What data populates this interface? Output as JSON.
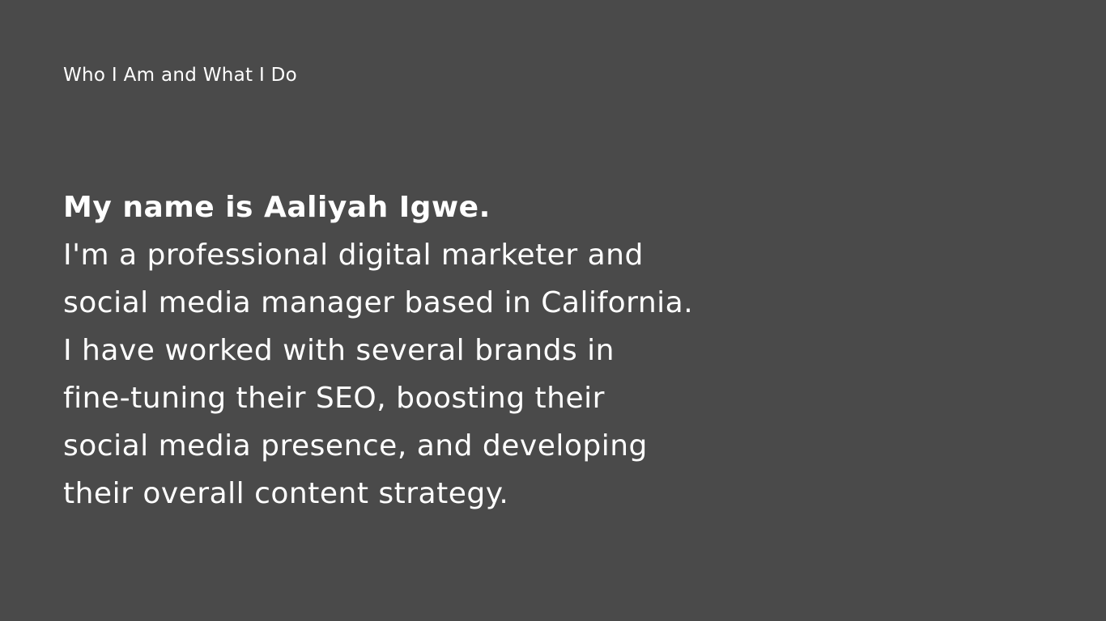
{
  "colors": {
    "background": "#4a4a4a",
    "text": "#ffffff"
  },
  "slide": {
    "kicker": "Who I Am and What I Do",
    "headline": "My name is Aaliyah Igwe.",
    "lines": [
      "I'm a professional digital marketer and",
      "social media manager based in California.",
      "I have worked with several brands in",
      "fine-tuning their SEO, boosting their",
      "social media presence, and developing",
      "their overall content strategy."
    ]
  }
}
